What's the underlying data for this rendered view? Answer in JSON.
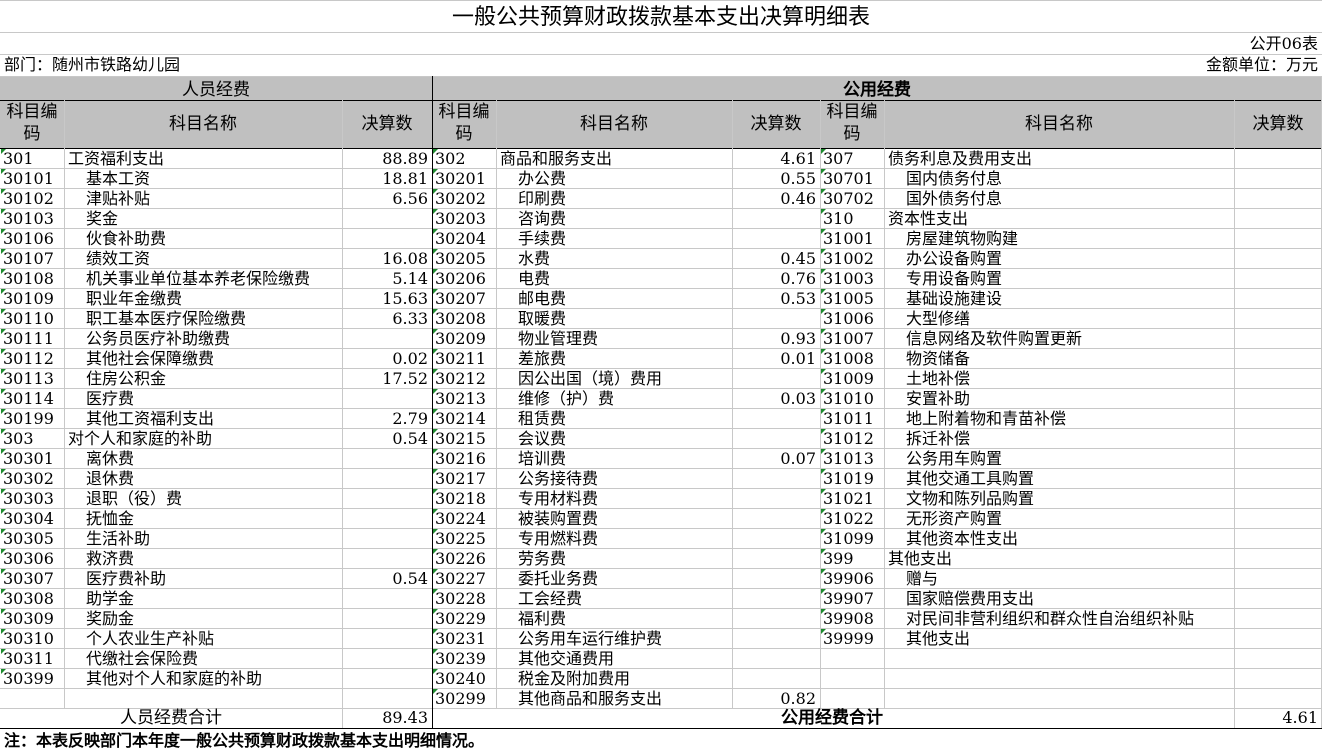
{
  "title": "一般公共预算财政拨款基本支出决算明细表",
  "table_no": "公开06表",
  "department": "部门：随州市铁路幼儿园",
  "unit": "金额单位：万元",
  "sections": {
    "personnel": "人员经费",
    "public": "公用经费"
  },
  "headers": {
    "code": "科目编码",
    "name": "科目名称",
    "amount": "决算数"
  },
  "personnel_rows": [
    {
      "code": "301",
      "name": "工资福利支出",
      "amount": "88.89",
      "level": 0
    },
    {
      "code": "30101",
      "name": "基本工资",
      "amount": "18.81",
      "level": 1
    },
    {
      "code": "30102",
      "name": "津贴补贴",
      "amount": "6.56",
      "level": 1
    },
    {
      "code": "30103",
      "name": "奖金",
      "amount": "",
      "level": 1
    },
    {
      "code": "30106",
      "name": "伙食补助费",
      "amount": "",
      "level": 1
    },
    {
      "code": "30107",
      "name": "绩效工资",
      "amount": "16.08",
      "level": 1
    },
    {
      "code": "30108",
      "name": "机关事业单位基本养老保险缴费",
      "amount": "5.14",
      "level": 1
    },
    {
      "code": "30109",
      "name": "职业年金缴费",
      "amount": "15.63",
      "level": 1
    },
    {
      "code": "30110",
      "name": "职工基本医疗保险缴费",
      "amount": "6.33",
      "level": 1
    },
    {
      "code": "30111",
      "name": "公务员医疗补助缴费",
      "amount": "",
      "level": 1
    },
    {
      "code": "30112",
      "name": "其他社会保障缴费",
      "amount": "0.02",
      "level": 1
    },
    {
      "code": "30113",
      "name": "住房公积金",
      "amount": "17.52",
      "level": 1
    },
    {
      "code": "30114",
      "name": "医疗费",
      "amount": "",
      "level": 1
    },
    {
      "code": "30199",
      "name": "其他工资福利支出",
      "amount": "2.79",
      "level": 1
    },
    {
      "code": "303",
      "name": "对个人和家庭的补助",
      "amount": "0.54",
      "level": 0
    },
    {
      "code": "30301",
      "name": "离休费",
      "amount": "",
      "level": 1
    },
    {
      "code": "30302",
      "name": "退休费",
      "amount": "",
      "level": 1
    },
    {
      "code": "30303",
      "name": "退职（役）费",
      "amount": "",
      "level": 1
    },
    {
      "code": "30304",
      "name": "抚恤金",
      "amount": "",
      "level": 1
    },
    {
      "code": "30305",
      "name": "生活补助",
      "amount": "",
      "level": 1
    },
    {
      "code": "30306",
      "name": "救济费",
      "amount": "",
      "level": 1
    },
    {
      "code": "30307",
      "name": "医疗费补助",
      "amount": "0.54",
      "level": 1
    },
    {
      "code": "30308",
      "name": "助学金",
      "amount": "",
      "level": 1
    },
    {
      "code": "30309",
      "name": "奖励金",
      "amount": "",
      "level": 1
    },
    {
      "code": "30310",
      "name": "个人农业生产补贴",
      "amount": "",
      "level": 1
    },
    {
      "code": "30311",
      "name": "代缴社会保险费",
      "amount": "",
      "level": 1
    },
    {
      "code": "30399",
      "name": "其他对个人和家庭的补助",
      "amount": "",
      "level": 1
    },
    {
      "code": "",
      "name": "",
      "amount": "",
      "level": 1
    }
  ],
  "public_rows_a": [
    {
      "code": "302",
      "name": "商品和服务支出",
      "amount": "4.61",
      "level": 0
    },
    {
      "code": "30201",
      "name": "办公费",
      "amount": "0.55",
      "level": 1
    },
    {
      "code": "30202",
      "name": "印刷费",
      "amount": "0.46",
      "level": 1
    },
    {
      "code": "30203",
      "name": "咨询费",
      "amount": "",
      "level": 1
    },
    {
      "code": "30204",
      "name": "手续费",
      "amount": "",
      "level": 1
    },
    {
      "code": "30205",
      "name": "水费",
      "amount": "0.45",
      "level": 1
    },
    {
      "code": "30206",
      "name": "电费",
      "amount": "0.76",
      "level": 1
    },
    {
      "code": "30207",
      "name": "邮电费",
      "amount": "0.53",
      "level": 1
    },
    {
      "code": "30208",
      "name": "取暖费",
      "amount": "",
      "level": 1
    },
    {
      "code": "30209",
      "name": "物业管理费",
      "amount": "0.93",
      "level": 1
    },
    {
      "code": "30211",
      "name": "差旅费",
      "amount": "0.01",
      "level": 1
    },
    {
      "code": "30212",
      "name": "因公出国（境）费用",
      "amount": "",
      "level": 1
    },
    {
      "code": "30213",
      "name": "维修（护）费",
      "amount": "0.03",
      "level": 1
    },
    {
      "code": "30214",
      "name": "租赁费",
      "amount": "",
      "level": 1
    },
    {
      "code": "30215",
      "name": "会议费",
      "amount": "",
      "level": 1
    },
    {
      "code": "30216",
      "name": "培训费",
      "amount": "0.07",
      "level": 1
    },
    {
      "code": "30217",
      "name": "公务接待费",
      "amount": "",
      "level": 1
    },
    {
      "code": "30218",
      "name": "专用材料费",
      "amount": "",
      "level": 1
    },
    {
      "code": "30224",
      "name": "被装购置费",
      "amount": "",
      "level": 1
    },
    {
      "code": "30225",
      "name": "专用燃料费",
      "amount": "",
      "level": 1
    },
    {
      "code": "30226",
      "name": "劳务费",
      "amount": "",
      "level": 1
    },
    {
      "code": "30227",
      "name": "委托业务费",
      "amount": "",
      "level": 1
    },
    {
      "code": "30228",
      "name": "工会经费",
      "amount": "",
      "level": 1
    },
    {
      "code": "30229",
      "name": "福利费",
      "amount": "",
      "level": 1
    },
    {
      "code": "30231",
      "name": "公务用车运行维护费",
      "amount": "",
      "level": 1
    },
    {
      "code": "30239",
      "name": "其他交通费用",
      "amount": "",
      "level": 1
    },
    {
      "code": "30240",
      "name": "税金及附加费用",
      "amount": "",
      "level": 1
    },
    {
      "code": "30299",
      "name": "其他商品和服务支出",
      "amount": "0.82",
      "level": 1
    }
  ],
  "public_rows_b": [
    {
      "code": "307",
      "name": "债务利息及费用支出",
      "amount": "",
      "level": 0
    },
    {
      "code": "30701",
      "name": "国内债务付息",
      "amount": "",
      "level": 1
    },
    {
      "code": "30702",
      "name": "国外债务付息",
      "amount": "",
      "level": 1
    },
    {
      "code": "310",
      "name": "资本性支出",
      "amount": "",
      "level": 0
    },
    {
      "code": "31001",
      "name": "房屋建筑物购建",
      "amount": "",
      "level": 1
    },
    {
      "code": "31002",
      "name": "办公设备购置",
      "amount": "",
      "level": 1
    },
    {
      "code": "31003",
      "name": "专用设备购置",
      "amount": "",
      "level": 1
    },
    {
      "code": "31005",
      "name": "基础设施建设",
      "amount": "",
      "level": 1
    },
    {
      "code": "31006",
      "name": "大型修缮",
      "amount": "",
      "level": 1
    },
    {
      "code": "31007",
      "name": "信息网络及软件购置更新",
      "amount": "",
      "level": 1
    },
    {
      "code": "31008",
      "name": "物资储备",
      "amount": "",
      "level": 1
    },
    {
      "code": "31009",
      "name": "土地补偿",
      "amount": "",
      "level": 1
    },
    {
      "code": "31010",
      "name": "安置补助",
      "amount": "",
      "level": 1
    },
    {
      "code": "31011",
      "name": "地上附着物和青苗补偿",
      "amount": "",
      "level": 1
    },
    {
      "code": "31012",
      "name": "拆迁补偿",
      "amount": "",
      "level": 1
    },
    {
      "code": "31013",
      "name": "公务用车购置",
      "amount": "",
      "level": 1
    },
    {
      "code": "31019",
      "name": "其他交通工具购置",
      "amount": "",
      "level": 1
    },
    {
      "code": "31021",
      "name": "文物和陈列品购置",
      "amount": "",
      "level": 1
    },
    {
      "code": "31022",
      "name": "无形资产购置",
      "amount": "",
      "level": 1
    },
    {
      "code": "31099",
      "name": "其他资本性支出",
      "amount": "",
      "level": 1
    },
    {
      "code": "399",
      "name": "其他支出",
      "amount": "",
      "level": 0
    },
    {
      "code": "39906",
      "name": "赠与",
      "amount": "",
      "level": 1
    },
    {
      "code": "39907",
      "name": "国家赔偿费用支出",
      "amount": "",
      "level": 1
    },
    {
      "code": "39908",
      "name": "对民间非营利组织和群众性自治组织补贴",
      "amount": "",
      "level": 1
    },
    {
      "code": "39999",
      "name": "其他支出",
      "amount": "",
      "level": 1
    }
  ],
  "totals": {
    "personnel_label": "人员经费合计",
    "personnel_value": "89.43",
    "public_label": "公用经费合计",
    "public_value": "4.61"
  },
  "note": "注：本表反映部门本年度一般公共预算财政拨款基本支出明细情况。",
  "colors": {
    "header_bg": "#c0c0c0",
    "grid": "#c8c8c8",
    "marker": "#1d8a2e"
  }
}
